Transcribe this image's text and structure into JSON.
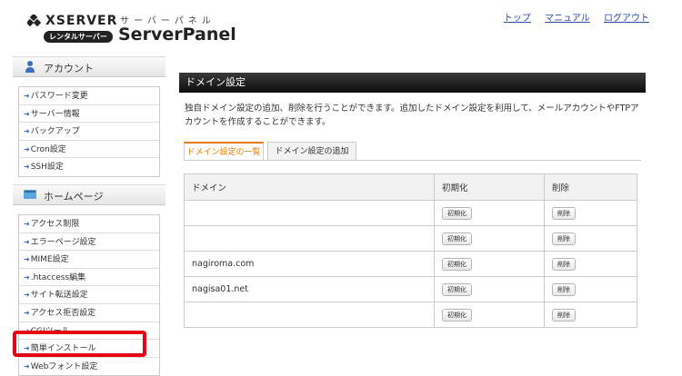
{
  "brand": {
    "name": "XSERVER",
    "sub": "レンタルサーバー",
    "kana": "サーバーパネル",
    "title": "ServerPanel"
  },
  "toplinks": [
    "トップ",
    "マニュアル",
    "ログアウト"
  ],
  "sidebar": {
    "account": {
      "title": "アカウント",
      "items": [
        "パスワード変更",
        "サーバー情報",
        "バックアップ",
        "Cron設定",
        "SSH設定"
      ]
    },
    "homepage": {
      "title": "ホームページ",
      "items": [
        "アクセス制限",
        "エラーページ設定",
        "MIME設定",
        ".htaccess編集",
        "サイト転送設定",
        "アクセス拒否設定",
        "CGIツール",
        "簡単インストール",
        "Webフォント設定"
      ]
    }
  },
  "main": {
    "title": "ドメイン設定",
    "description": "独自ドメイン設定の追加、削除を行うことができます。追加したドメイン設定を利用して、メールアカウントやFTPアカウントを作成することができます。",
    "tabs": [
      "ドメイン設定の一覧",
      "ドメイン設定の追加"
    ],
    "table": {
      "headers": [
        "ドメイン",
        "初期化",
        "削除"
      ],
      "rows": [
        {
          "domain": "",
          "init": "初期化",
          "del": "削除"
        },
        {
          "domain": "",
          "init": "初期化",
          "del": "削除"
        },
        {
          "domain": "nagiroma.com",
          "init": "初期化",
          "del": "削除"
        },
        {
          "domain": "nagisa01.net",
          "init": "初期化",
          "del": "削除"
        },
        {
          "domain": "",
          "init": "初期化",
          "del": "削除"
        }
      ]
    }
  },
  "colors": {
    "accent": "#e67a00",
    "highlight": "#e60012",
    "link": "#2a4fa8"
  }
}
